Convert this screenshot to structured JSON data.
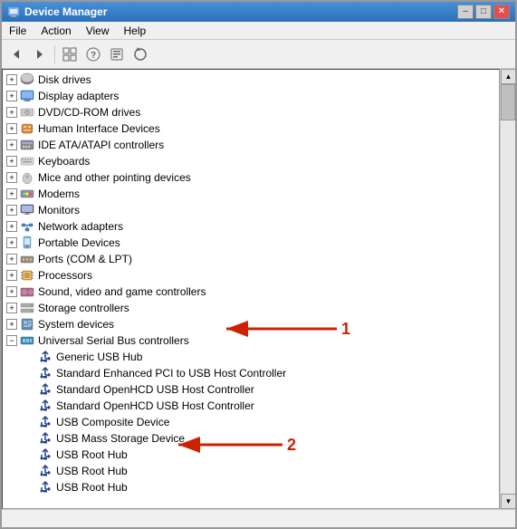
{
  "window": {
    "title": "Device Manager",
    "title_btn_minimize": "–",
    "title_btn_restore": "□",
    "title_btn_close": "✕"
  },
  "menu": {
    "items": [
      "File",
      "Action",
      "View",
      "Help"
    ]
  },
  "toolbar": {
    "buttons": [
      "←",
      "→",
      "□",
      "?",
      "□",
      "↺"
    ]
  },
  "tree": {
    "root_items": [
      {
        "id": "disk-drives",
        "label": "Disk drives",
        "level": 0,
        "expanded": false,
        "icon": "disk"
      },
      {
        "id": "display-adapters",
        "label": "Display adapters",
        "level": 0,
        "expanded": false,
        "icon": "display"
      },
      {
        "id": "dvd-cdrom",
        "label": "DVD/CD-ROM drives",
        "level": 0,
        "expanded": false,
        "icon": "dvd"
      },
      {
        "id": "human-interface",
        "label": "Human Interface Devices",
        "level": 0,
        "expanded": false,
        "icon": "hid"
      },
      {
        "id": "ide-atapi",
        "label": "IDE ATA/ATAPI controllers",
        "level": 0,
        "expanded": false,
        "icon": "ide"
      },
      {
        "id": "keyboards",
        "label": "Keyboards",
        "level": 0,
        "expanded": false,
        "icon": "keyboard"
      },
      {
        "id": "mice",
        "label": "Mice and other pointing devices",
        "level": 0,
        "expanded": false,
        "icon": "mouse"
      },
      {
        "id": "modems",
        "label": "Modems",
        "level": 0,
        "expanded": false,
        "icon": "modem"
      },
      {
        "id": "monitors",
        "label": "Monitors",
        "level": 0,
        "expanded": false,
        "icon": "monitor"
      },
      {
        "id": "network-adapters",
        "label": "Network adapters",
        "level": 0,
        "expanded": false,
        "icon": "network"
      },
      {
        "id": "portable-devices",
        "label": "Portable Devices",
        "level": 0,
        "expanded": false,
        "icon": "portable"
      },
      {
        "id": "ports",
        "label": "Ports (COM & LPT)",
        "level": 0,
        "expanded": false,
        "icon": "ports"
      },
      {
        "id": "processors",
        "label": "Processors",
        "level": 0,
        "expanded": false,
        "icon": "processor"
      },
      {
        "id": "sound-video",
        "label": "Sound, video and game controllers",
        "level": 0,
        "expanded": false,
        "icon": "sound"
      },
      {
        "id": "storage-controllers",
        "label": "Storage controllers",
        "level": 0,
        "expanded": false,
        "icon": "storage"
      },
      {
        "id": "system-devices",
        "label": "System devices",
        "level": 0,
        "expanded": false,
        "icon": "system"
      },
      {
        "id": "usb-controllers",
        "label": "Universal Serial Bus controllers",
        "level": 0,
        "expanded": true,
        "icon": "usb",
        "selected": false
      },
      {
        "id": "generic-usb-hub",
        "label": "Generic USB Hub",
        "level": 1,
        "expanded": false,
        "icon": "usb-device"
      },
      {
        "id": "std-enhanced-pci",
        "label": "Standard Enhanced PCI to USB Host Controller",
        "level": 1,
        "expanded": false,
        "icon": "usb-device"
      },
      {
        "id": "std-openhcd-1",
        "label": "Standard OpenHCD USB Host Controller",
        "level": 1,
        "expanded": false,
        "icon": "usb-device"
      },
      {
        "id": "std-openhcd-2",
        "label": "Standard OpenHCD USB Host Controller",
        "level": 1,
        "expanded": false,
        "icon": "usb-device"
      },
      {
        "id": "usb-composite",
        "label": "USB Composite Device",
        "level": 1,
        "expanded": false,
        "icon": "usb-device"
      },
      {
        "id": "usb-mass-storage",
        "label": "USB Mass Storage Device",
        "level": 1,
        "expanded": false,
        "icon": "usb-device"
      },
      {
        "id": "usb-root-hub-1",
        "label": "USB Root Hub",
        "level": 1,
        "expanded": false,
        "icon": "usb-device"
      },
      {
        "id": "usb-root-hub-2",
        "label": "USB Root Hub",
        "level": 1,
        "expanded": false,
        "icon": "usb-device"
      },
      {
        "id": "usb-root-hub-3",
        "label": "USB Root Hub",
        "level": 1,
        "expanded": false,
        "icon": "usb-device"
      }
    ]
  },
  "annotations": {
    "arrow1": {
      "label": "1",
      "color": "#cc2200"
    },
    "arrow2": {
      "label": "2",
      "color": "#cc2200"
    }
  },
  "colors": {
    "title_bar_top": "#4a90d9",
    "title_bar_bottom": "#2a70b9",
    "arrow_color": "#cc2200",
    "selected_bg": "#316ac5"
  }
}
